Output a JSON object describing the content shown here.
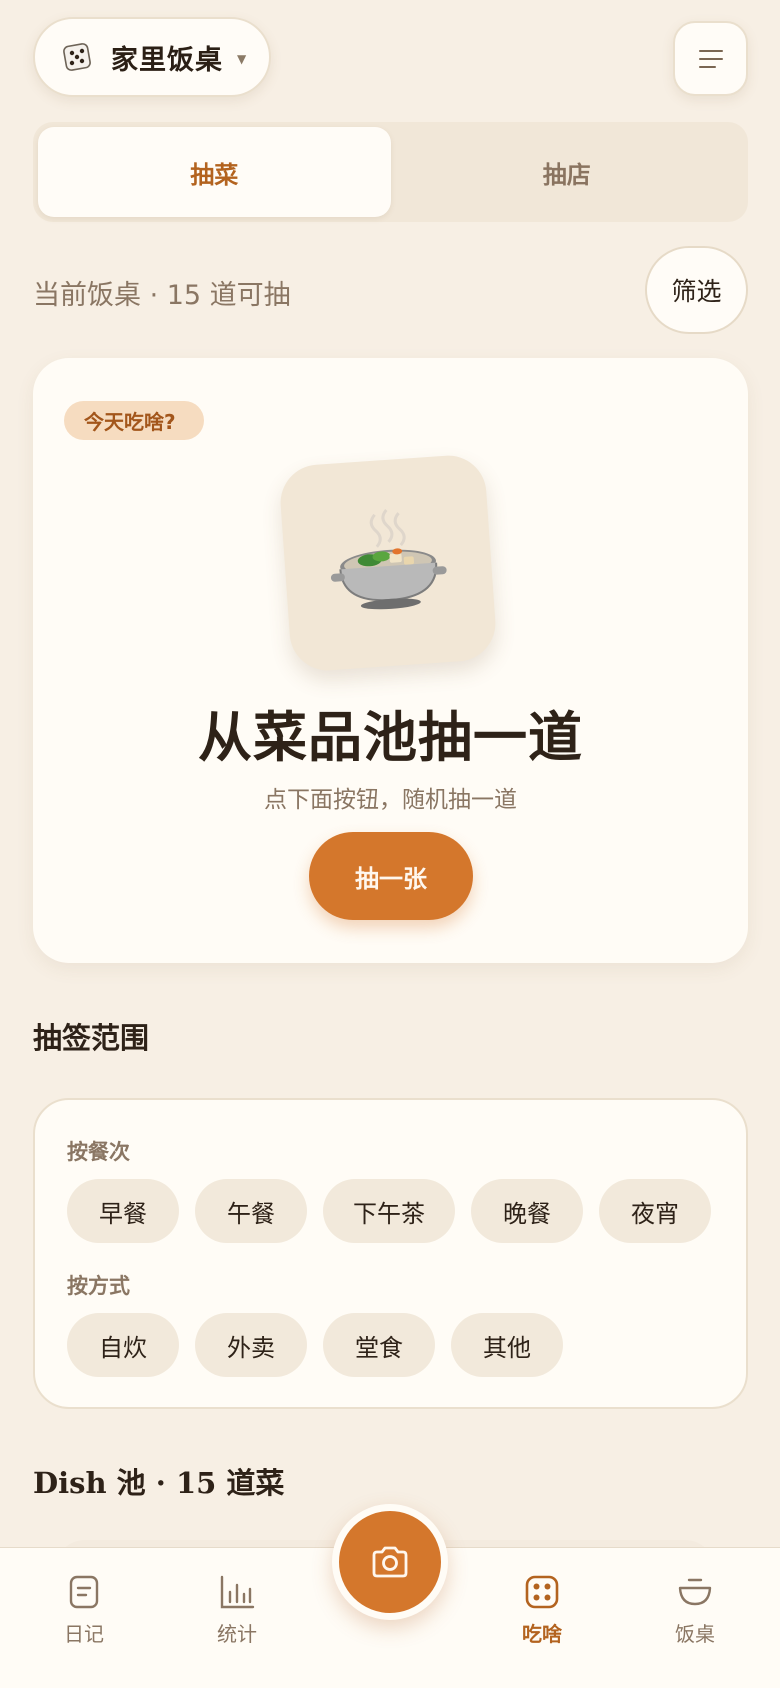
{
  "header": {
    "table_icon": "dice-icon",
    "table_name": "家里饭桌",
    "menu_icon": "hamburger-menu-icon"
  },
  "tabs": [
    {
      "label": "抽菜",
      "active": true
    },
    {
      "label": "抽店",
      "active": false
    }
  ],
  "pool_info": "当前饭桌 · 15 道可抽",
  "filter_label": "筛选",
  "draw_card": {
    "badge": "今天吃啥?",
    "dish_icon": "hot-pot-icon",
    "title": "从菜品池抽一道",
    "subtitle": "点下面按钮，随机抽一道",
    "button": "抽一张"
  },
  "scope": {
    "title": "抽签范围",
    "by_meal": {
      "label": "按餐次",
      "chips": [
        "早餐",
        "午餐",
        "下午茶",
        "晚餐",
        "夜宵"
      ]
    },
    "by_method": {
      "label": "按方式",
      "chips": [
        "自炊",
        "外卖",
        "堂食",
        "其他"
      ]
    }
  },
  "dish_pool_title": "Dish 池 · 15 道菜",
  "nav": {
    "items": [
      {
        "label": "日记",
        "icon": "diary-icon",
        "active": false
      },
      {
        "label": "统计",
        "icon": "bar-chart-icon",
        "active": false
      },
      {
        "label": "吃啥",
        "icon": "dice-icon",
        "active": true
      },
      {
        "label": "饭桌",
        "icon": "bowl-icon",
        "active": false
      }
    ],
    "camera_icon": "camera-icon"
  },
  "colors": {
    "background": "#f7efe4",
    "accent": "#d4772c",
    "accent_text": "#b3631f",
    "card": "#fffcf6",
    "muted_text": "#8a7663"
  }
}
